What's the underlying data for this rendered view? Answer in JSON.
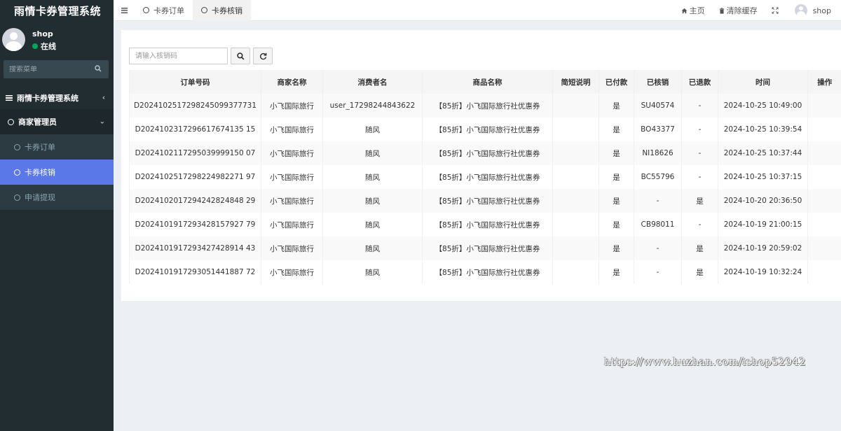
{
  "app": {
    "title": "雨情卡券管理系统"
  },
  "user": {
    "name": "shop",
    "status": "在线"
  },
  "sidebar": {
    "search_placeholder": "搜索菜单",
    "menu": {
      "root_label": "雨情卡券管理系统",
      "group_label": "商家管理员",
      "items": [
        {
          "label": "卡券订单",
          "active": false
        },
        {
          "label": "卡券核销",
          "active": true
        },
        {
          "label": "申请提现",
          "active": false
        }
      ]
    }
  },
  "topnav": {
    "tabs": [
      {
        "label": "卡券订单",
        "active": false
      },
      {
        "label": "卡券核销",
        "active": true
      }
    ],
    "home_label": "主页",
    "clear_cache_label": "清除缓存",
    "user_label": "shop"
  },
  "toolbar": {
    "search_placeholder": "请输入核销码"
  },
  "table": {
    "columns": [
      "订单号码",
      "商家名称",
      "消费者名",
      "商品名称",
      "简短说明",
      "已付款",
      "已核销",
      "已退款",
      "时间",
      "操作"
    ],
    "rows": [
      [
        "D2024102517298245099377731",
        "小飞国际旅行",
        "user_17298244843622",
        "【85折】小飞国际旅行社优惠券",
        "",
        "是",
        "SU40574",
        "-",
        "2024-10-25 10:49:00",
        ""
      ],
      [
        "D2024102317296617674135 15",
        "小飞国际旅行",
        "随风",
        "【85折】小飞国际旅行社优惠券",
        "",
        "是",
        "BO43377",
        "-",
        "2024-10-25 10:39:54",
        ""
      ],
      [
        "D2024102117295039999150 07",
        "小飞国际旅行",
        "随风",
        "【85折】小飞国际旅行社优惠券",
        "",
        "是",
        "NI18626",
        "-",
        "2024-10-25 10:37:44",
        ""
      ],
      [
        "D2024102517298224982271 97",
        "小飞国际旅行",
        "随风",
        "【85折】小飞国际旅行社优惠券",
        "",
        "是",
        "BC55796",
        "-",
        "2024-10-25 10:37:15",
        ""
      ],
      [
        "D2024102017294242824848 29",
        "小飞国际旅行",
        "随风",
        "【85折】小飞国际旅行社优惠券",
        "",
        "是",
        "-",
        "是",
        "2024-10-20 20:36:50",
        ""
      ],
      [
        "D2024101917293428157927 79",
        "小飞国际旅行",
        "随风",
        "【85折】小飞国际旅行社优惠券",
        "",
        "是",
        "CB98011",
        "-",
        "2024-10-19 21:00:15",
        ""
      ],
      [
        "D2024101917293427428914 43",
        "小飞国际旅行",
        "随风",
        "【85折】小飞国际旅行社优惠券",
        "",
        "是",
        "-",
        "是",
        "2024-10-19 20:59:02",
        ""
      ],
      [
        "D2024101917293051441887 72",
        "小飞国际旅行",
        "随风",
        "【85折】小飞国际旅行社优惠券",
        "",
        "是",
        "-",
        "是",
        "2024-10-19 10:32:24",
        ""
      ]
    ]
  },
  "watermark": "https://www.huzhan.com/ishop52942",
  "colors": {
    "sidebar_bg": "#222d32",
    "active_menu": "#5a78e8",
    "online_dot": "#00a65a"
  }
}
